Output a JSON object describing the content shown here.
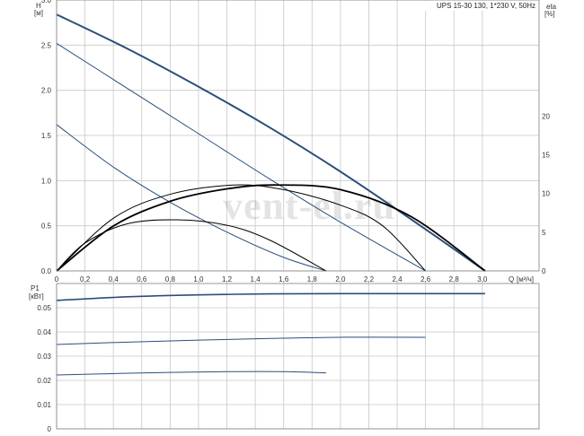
{
  "title": "UPS 15-30 130, 1*230 V, 50Hz",
  "watermark": "vent-el.ru",
  "colors": {
    "pump_curve": "#2a4f7a",
    "efficiency": "#000000",
    "power": "#2a4f7a"
  },
  "chart_data": [
    {
      "type": "line",
      "name": "head-efficiency",
      "ylabel_main": "H",
      "yunit_main": "[м]",
      "ylabel_right": "eta",
      "yunit_right": "[%]",
      "xlabel": "Q",
      "xunit": "[м³/ч]",
      "xlim": [
        0,
        3.4
      ],
      "ylim": [
        0,
        3.0
      ],
      "ylim_right": [
        0,
        35
      ],
      "xticks": [
        "0",
        "0,2",
        "0,4",
        "0,6",
        "0,8",
        "1,0",
        "1,2",
        "1,4",
        "1,6",
        "1,8",
        "2,0",
        "2,2",
        "2,4",
        "2,6",
        "2,8",
        "3,0"
      ],
      "yticks": [
        "0.0",
        "0.5",
        "1.0",
        "1.5",
        "2.0",
        "2.5",
        "3.0"
      ],
      "yticks_right": [
        "0",
        "5",
        "10",
        "15",
        "20"
      ],
      "grid": true,
      "head_curves": [
        {
          "x": [
            0,
            0.5,
            1.0,
            1.5,
            2.0,
            2.5,
            3.02
          ],
          "y": [
            2.84,
            2.46,
            2.04,
            1.59,
            1.1,
            0.57,
            0.0
          ]
        },
        {
          "x": [
            0,
            0.5,
            1.0,
            1.5,
            2.0,
            2.6
          ],
          "y": [
            2.52,
            2.02,
            1.52,
            1.02,
            0.54,
            0.0
          ]
        },
        {
          "x": [
            0,
            0.4,
            0.8,
            1.2,
            1.6,
            1.9
          ],
          "y": [
            1.62,
            1.15,
            0.76,
            0.43,
            0.15,
            0.0
          ]
        }
      ],
      "efficiency_curves": [
        {
          "x": [
            0,
            0.4,
            0.8,
            1.2,
            1.55,
            2.0,
            2.5,
            3.02
          ],
          "y": [
            0,
            5.8,
            9.0,
            10.6,
            11.1,
            10.5,
            7.0,
            0
          ]
        },
        {
          "x": [
            0,
            0.4,
            0.8,
            1.25,
            1.6,
            2.0,
            2.3,
            2.6
          ],
          "y": [
            0,
            6.8,
            9.9,
            11.1,
            10.5,
            8.5,
            5.8,
            0
          ]
        },
        {
          "x": [
            0,
            0.2,
            0.5,
            0.85,
            1.2,
            1.5,
            1.9
          ],
          "y": [
            0,
            3.6,
            6.1,
            6.6,
            5.9,
            4.0,
            0
          ]
        }
      ]
    },
    {
      "type": "line",
      "name": "power",
      "ylabel": "P1",
      "yunit": "[кВт]",
      "xlim": [
        0,
        3.4
      ],
      "ylim": [
        0,
        0.06
      ],
      "yticks": [
        "0",
        "0.01",
        "0.02",
        "0.03",
        "0.04",
        "0.05"
      ],
      "grid": true,
      "series": [
        {
          "x": [
            0,
            0.5,
            1.0,
            1.5,
            2.0,
            2.5,
            3.02
          ],
          "y": [
            0.053,
            0.0545,
            0.0553,
            0.0557,
            0.0558,
            0.0558,
            0.0558
          ]
        },
        {
          "x": [
            0,
            0.5,
            1.0,
            1.5,
            2.0,
            2.6
          ],
          "y": [
            0.0348,
            0.0358,
            0.0366,
            0.0373,
            0.0378,
            0.0378
          ]
        },
        {
          "x": [
            0,
            0.4,
            0.8,
            1.2,
            1.6,
            1.9
          ],
          "y": [
            0.0222,
            0.0228,
            0.0233,
            0.0236,
            0.0236,
            0.0231
          ]
        }
      ]
    }
  ]
}
